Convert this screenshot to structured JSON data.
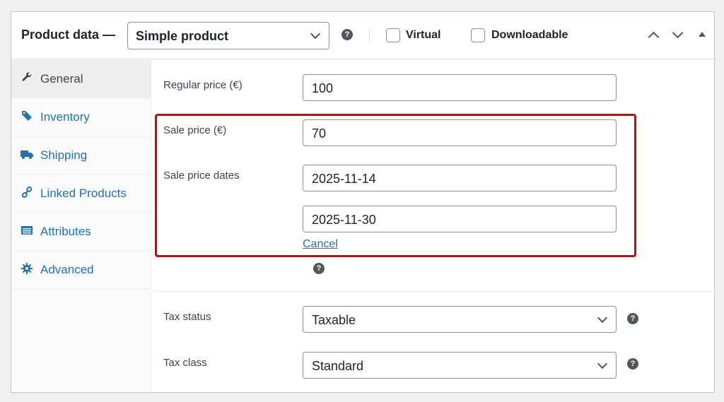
{
  "header": {
    "title": "Product data —",
    "product_type": "Simple product",
    "virtual_label": "Virtual",
    "downloadable_label": "Downloadable",
    "help_glyph": "?"
  },
  "sidebar": {
    "items": [
      {
        "label": "General",
        "icon": "wrench-icon",
        "active": true
      },
      {
        "label": "Inventory",
        "icon": "tag-icon"
      },
      {
        "label": "Shipping",
        "icon": "truck-icon"
      },
      {
        "label": "Linked Products",
        "icon": "link-icon"
      },
      {
        "label": "Attributes",
        "icon": "list-icon"
      },
      {
        "label": "Advanced",
        "icon": "gear-icon"
      }
    ]
  },
  "general": {
    "regular_price_label": "Regular price (€)",
    "regular_price_value": "100",
    "sale_price_label": "Sale price (€)",
    "sale_price_value": "70",
    "sale_dates_label": "Sale price dates",
    "sale_date_from": "2025-11-14",
    "sale_date_to": "2025-11-30",
    "cancel_label": "Cancel",
    "tax_status_label": "Tax status",
    "tax_status_value": "Taxable",
    "tax_class_label": "Tax class",
    "tax_class_value": "Standard"
  },
  "colors": {
    "accent": "#2271b1",
    "highlight": "#e00000"
  }
}
